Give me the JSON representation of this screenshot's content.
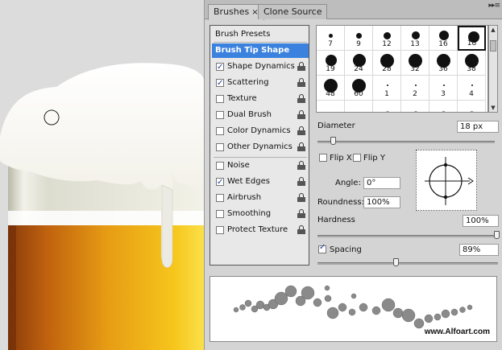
{
  "colors": {
    "selection": "#3b82df",
    "panel_bg": "#d4d4d4",
    "beer": "#e8a21a",
    "foam": "#f6f6f2"
  },
  "tabs": [
    {
      "label": "Brushes",
      "active": true,
      "close": "×"
    },
    {
      "label": "Clone Source",
      "active": false
    }
  ],
  "panel_menu": "▸▸≡",
  "options": {
    "header": "Brush Presets",
    "selected": "Brush Tip Shape",
    "items_a": [
      {
        "label": "Shape Dynamics",
        "checked": true
      },
      {
        "label": "Scattering",
        "checked": true
      },
      {
        "label": "Texture",
        "checked": false
      },
      {
        "label": "Dual Brush",
        "checked": false
      },
      {
        "label": "Color Dynamics",
        "checked": false
      },
      {
        "label": "Other Dynamics",
        "checked": false
      }
    ],
    "items_b": [
      {
        "label": "Noise",
        "checked": false
      },
      {
        "label": "Wet Edges",
        "checked": true
      },
      {
        "label": "Airbrush",
        "checked": false
      },
      {
        "label": "Smoothing",
        "checked": false
      },
      {
        "label": "Protect Texture",
        "checked": false
      }
    ]
  },
  "brushes": [
    {
      "label": "7",
      "size": 5
    },
    {
      "label": "9",
      "size": 7
    },
    {
      "label": "12",
      "size": 9
    },
    {
      "label": "13",
      "size": 10
    },
    {
      "label": "16",
      "size": 12
    },
    {
      "label": "18",
      "size": 14,
      "selected": true
    },
    {
      "label": "19",
      "size": 14
    },
    {
      "label": "24",
      "size": 16
    },
    {
      "label": "28",
      "size": 17
    },
    {
      "label": "32",
      "size": 17
    },
    {
      "label": "36",
      "size": 17
    },
    {
      "label": "38",
      "size": 17
    },
    {
      "label": "48",
      "size": 17
    },
    {
      "label": "60",
      "size": 17
    },
    {
      "label": "1",
      "size": 2
    },
    {
      "label": "2",
      "size": 2
    },
    {
      "label": "3",
      "size": 2
    },
    {
      "label": "4",
      "size": 2
    },
    {
      "label": "",
      "size": 3
    },
    {
      "label": "",
      "size": 3
    },
    {
      "label": "",
      "size": 4
    },
    {
      "label": "",
      "size": 4
    },
    {
      "label": "",
      "size": 5
    },
    {
      "label": "",
      "size": 5
    }
  ],
  "controls": {
    "diameter_label": "Diameter",
    "diameter_value": "18 px",
    "flip_x_label": "Flip X",
    "flip_y_label": "Flip Y",
    "angle_label": "Angle:",
    "angle_value": "0°",
    "roundness_label": "Roundness:",
    "roundness_value": "100%",
    "hardness_label": "Hardness",
    "hardness_value": "100%",
    "spacing_label": "Spacing",
    "spacing_value": "89%",
    "spacing_checked": true
  },
  "preview": {
    "credit": "www.Alfoart.com"
  }
}
